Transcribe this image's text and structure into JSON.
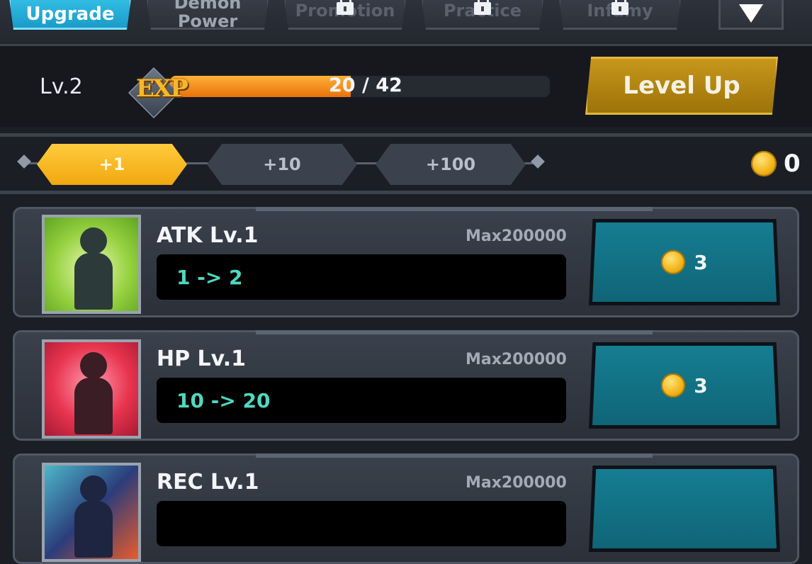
{
  "tabs": [
    {
      "label": "Upgrade",
      "active": true,
      "locked": false
    },
    {
      "label": "Demon Power",
      "active": false,
      "locked": false
    },
    {
      "label": "Promotion",
      "active": false,
      "locked": true
    },
    {
      "label": "Practice",
      "active": false,
      "locked": true
    },
    {
      "label": "Infamy",
      "active": false,
      "locked": true
    }
  ],
  "tab_icons": {
    "lock": "lock-icon",
    "dropdown": "triangle-down-icon"
  },
  "level": {
    "label": "Lv.2",
    "exp_label": "EXP",
    "exp_current": 20,
    "exp_max": 42,
    "exp_text": "20 / 42",
    "level_up_label": "Level Up"
  },
  "multipliers": {
    "options": [
      "+1",
      "+10",
      "+100"
    ],
    "selected": "+1"
  },
  "coins": {
    "icon": "gold-coin-icon",
    "count": "0"
  },
  "stats": [
    {
      "title": "ATK Lv.1",
      "max": "Max200000",
      "change": "1 -> 2",
      "cost": "3",
      "portrait": "atk-figure-portrait"
    },
    {
      "title": "HP Lv.1",
      "max": "Max200000",
      "change": "10 -> 20",
      "cost": "3",
      "portrait": "hp-heart-portrait"
    },
    {
      "title": "REC Lv.1",
      "max": "Max200000",
      "change": "",
      "cost": "",
      "portrait": "rec-cross-portrait"
    }
  ],
  "colors": {
    "accent_blue": "#1a9cc9",
    "exp_orange": "#e8720a",
    "level_up_gold": "#c9981c",
    "multiplier_active": "#f0a810",
    "buy_teal": "#167d92",
    "value_green": "#4fd8c0"
  }
}
